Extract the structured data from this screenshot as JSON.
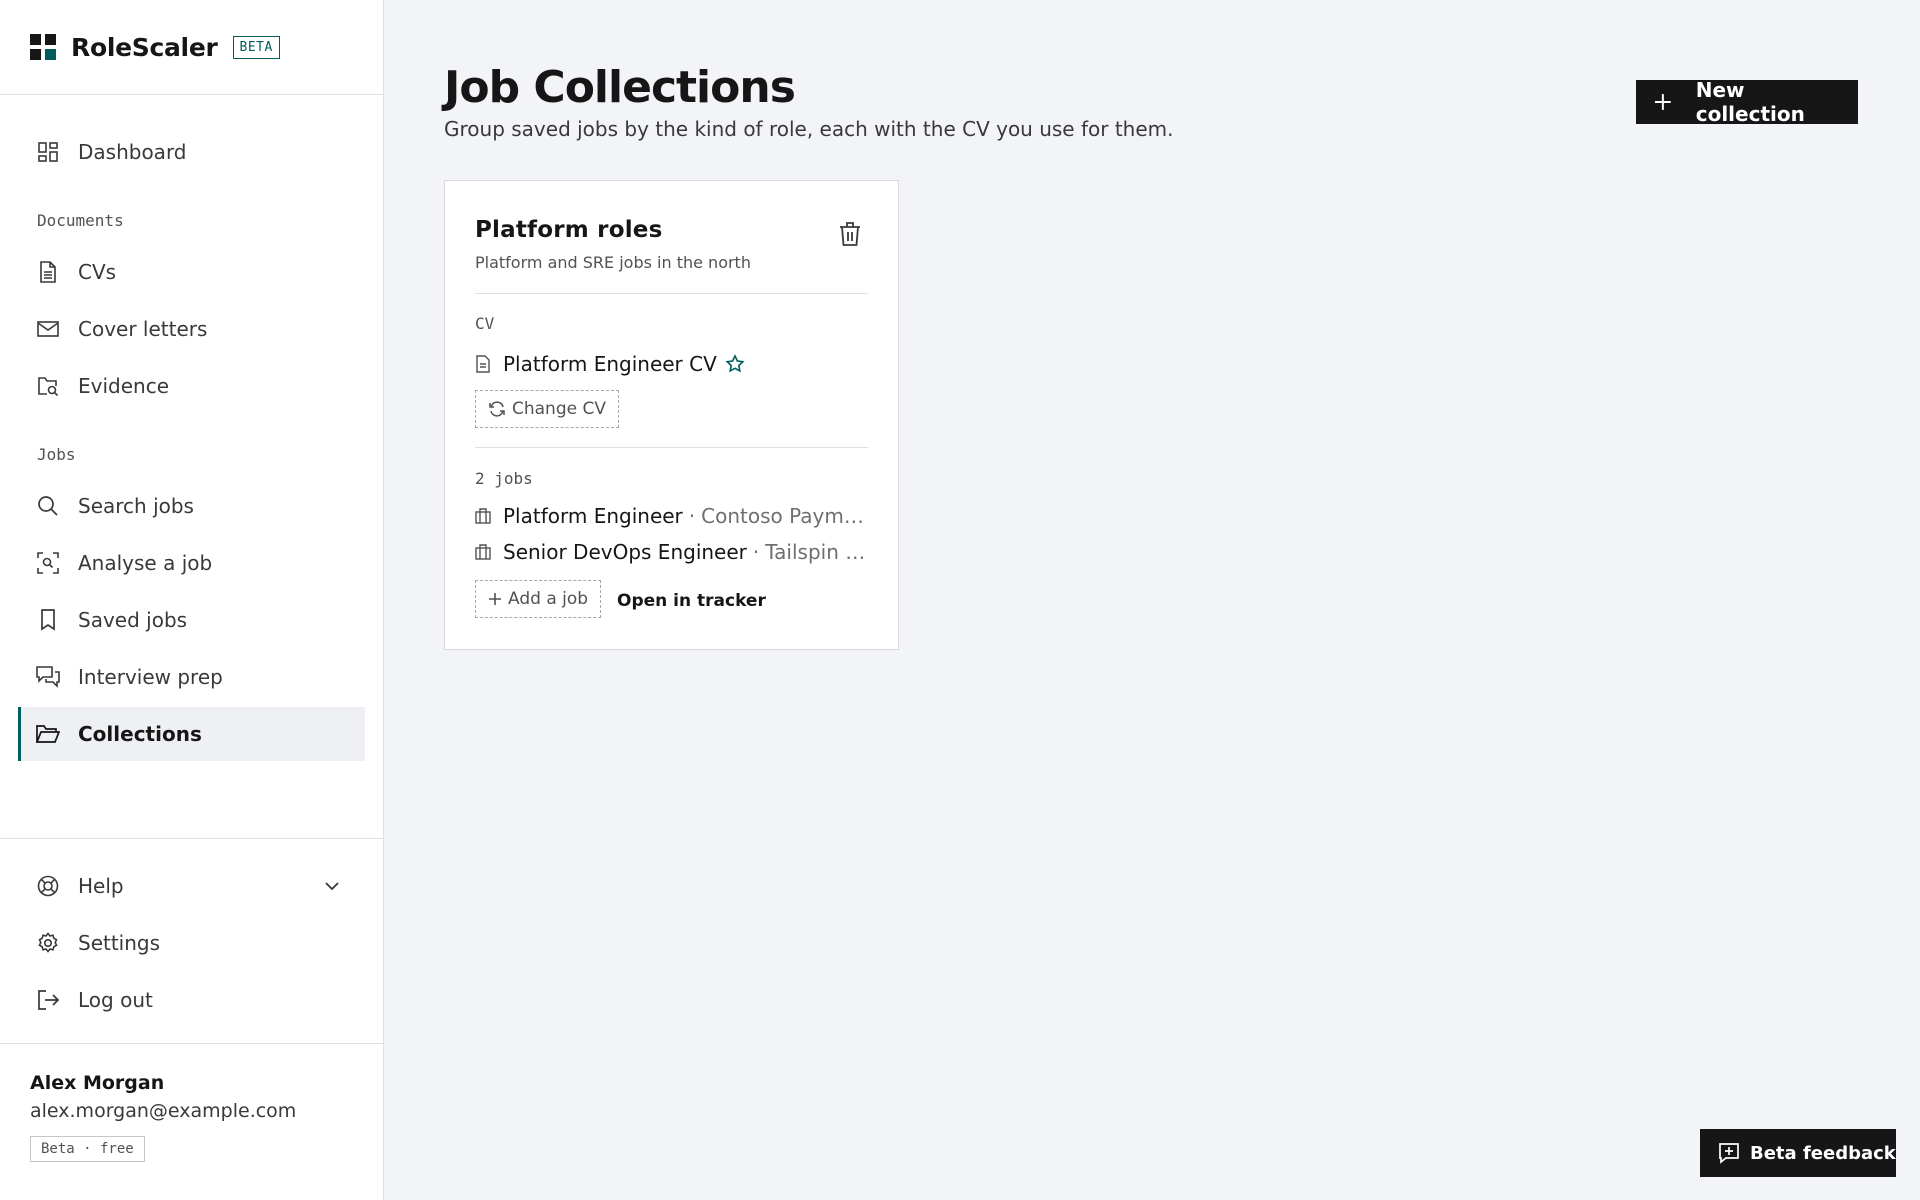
{
  "brand": {
    "name": "RoleScaler",
    "badge": "BETA"
  },
  "nav": {
    "dashboard": "Dashboard",
    "documents_heading": "Documents",
    "cvs": "CVs",
    "cover_letters": "Cover letters",
    "evidence": "Evidence",
    "jobs_heading": "Jobs",
    "search_jobs": "Search jobs",
    "analyse_job": "Analyse a job",
    "saved_jobs": "Saved jobs",
    "interview_prep": "Interview prep",
    "collections": "Collections",
    "active": "Collections"
  },
  "bottom_nav": {
    "help": "Help",
    "settings": "Settings",
    "logout": "Log out"
  },
  "user": {
    "name": "Alex Morgan",
    "email": "alex.morgan@example.com",
    "plan": "Beta · free"
  },
  "page": {
    "title": "Job Collections",
    "subtitle": "Group saved jobs by the kind of role, each with the CV you use for them.",
    "new_button": "New collection"
  },
  "collection": {
    "title": "Platform roles",
    "description": "Platform and SRE jobs in the north",
    "cv_label": "CV",
    "cv_name": "Platform Engineer CV",
    "change_cv": "Change CV",
    "jobs_count": "2 jobs",
    "jobs": [
      {
        "title": "Platform Engineer",
        "company": "Contoso Payments"
      },
      {
        "title": "Senior DevOps Engineer",
        "company": "Tailspin Cloud"
      }
    ],
    "add_job": "Add a job",
    "open_tracker": "Open in tracker"
  },
  "feedback": {
    "label": "Beta feedback"
  },
  "colors": {
    "accent": "#005d5d",
    "dark": "#161616",
    "background": "#f2f4f8"
  }
}
